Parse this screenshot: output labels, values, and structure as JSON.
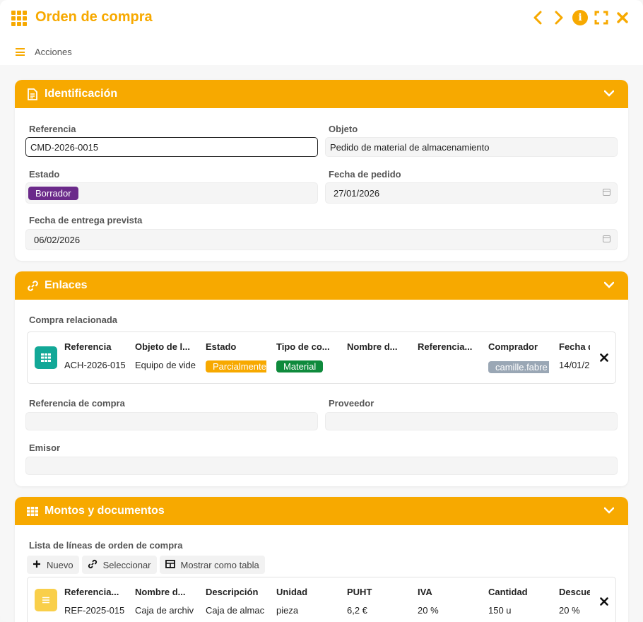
{
  "header": {
    "title": "Orden de compra",
    "actions_label": "Acciones"
  },
  "icons": {
    "app": "grid-icon",
    "prev": "chevron-left-icon",
    "next": "chevron-right-icon",
    "info": "info-icon",
    "fullscreen": "expand-icon",
    "close": "close-icon"
  },
  "colors": {
    "accent": "#f7a900",
    "status_draft": "#6b2a8a",
    "status_partial": "#f7a900",
    "status_material": "#0f8a3c",
    "buyer_badge": "#9aa7b5"
  },
  "identification": {
    "title": "Identificación",
    "reference_label": "Referencia",
    "reference_value": "CMD-2026-0015",
    "object_label": "Objeto",
    "object_value": "Pedido de material de almacenamiento",
    "status_label": "Estado",
    "status_value": "Borrador",
    "order_date_label": "Fecha de pedido",
    "order_date_value": "27/01/2026",
    "delivery_label": "Fecha de entrega prevista",
    "delivery_value": "06/02/2026"
  },
  "links": {
    "title": "Enlaces",
    "related_label": "Compra relacionada",
    "columns": [
      "Referencia",
      "Objeto de l...",
      "Estado",
      "Tipo de co...",
      "Nombre d...",
      "Referencia...",
      "Comprador",
      "Fecha d"
    ],
    "row": {
      "reference": "ACH-2026-015",
      "object": "Equipo de vide",
      "status": "Parcialmente",
      "type": "Material",
      "buyer": "camille.fabre",
      "date": "14/01/2"
    },
    "purchase_ref_label": "Referencia de compra",
    "supplier_label": "Proveedor",
    "issuer_label": "Emisor"
  },
  "amounts": {
    "title": "Montos y documentos",
    "lines_label": "Lista de líneas de orden de compra",
    "btn_new": "Nuevo",
    "btn_select": "Seleccionar",
    "btn_table": "Mostrar como tabla",
    "columns": [
      "Referencia...",
      "Nombre d...",
      "Descripción",
      "Unidad",
      "PUHT",
      "IVA",
      "Cantidad",
      "Descue"
    ],
    "row": [
      "REF-2025-015",
      "Caja de archiv",
      "Caja de almac",
      "pieza",
      "6,2 €",
      "20 %",
      "150 u",
      "20 %"
    ]
  }
}
